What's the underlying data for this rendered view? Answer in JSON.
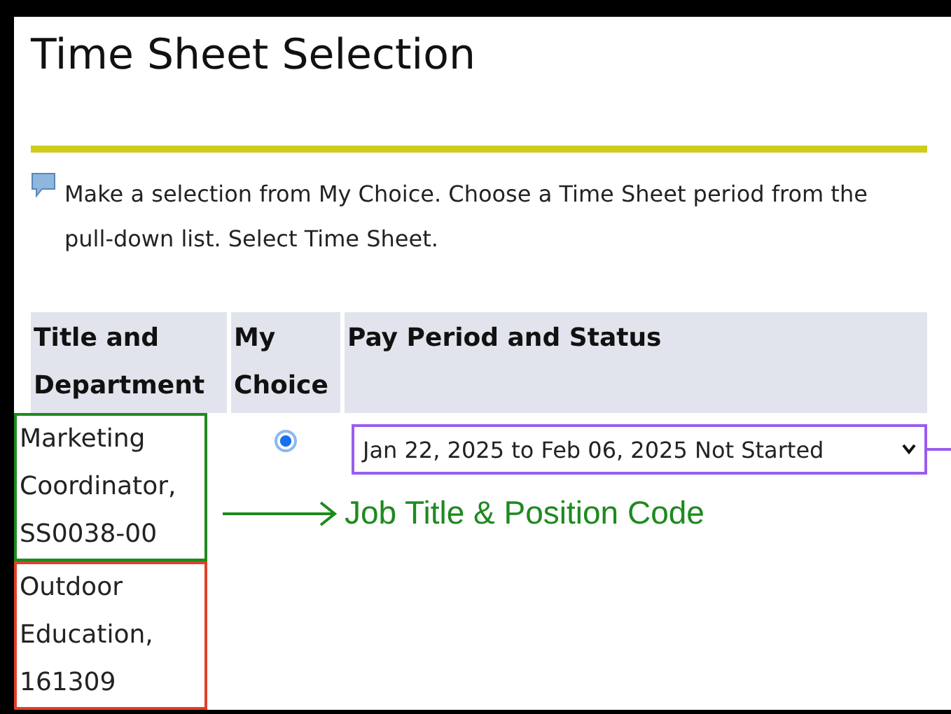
{
  "page": {
    "title": "Time Sheet Selection",
    "instruction": "Make a selection from My Choice. Choose a Time Sheet period from the pull-down list. Select Time Sheet."
  },
  "table": {
    "columns": [
      "Title and Department",
      "My Choice",
      "Pay Period and Status"
    ],
    "rows": [
      {
        "job": {
          "text": "Marketing Coordinator, SS0038-00",
          "color": "#1e8a1e"
        },
        "department": {
          "text": "Outdoor Education, 161309",
          "color": "#e0402a"
        },
        "my_choice": {
          "selected": true
        },
        "pay_period": {
          "value": "Jan 22, 2025 to Feb 06, 2025 Not Started",
          "color": "#9a5cf0"
        }
      }
    ]
  },
  "annotation": {
    "label": "Job Title & Position Code",
    "color": "#1e8a1e"
  }
}
